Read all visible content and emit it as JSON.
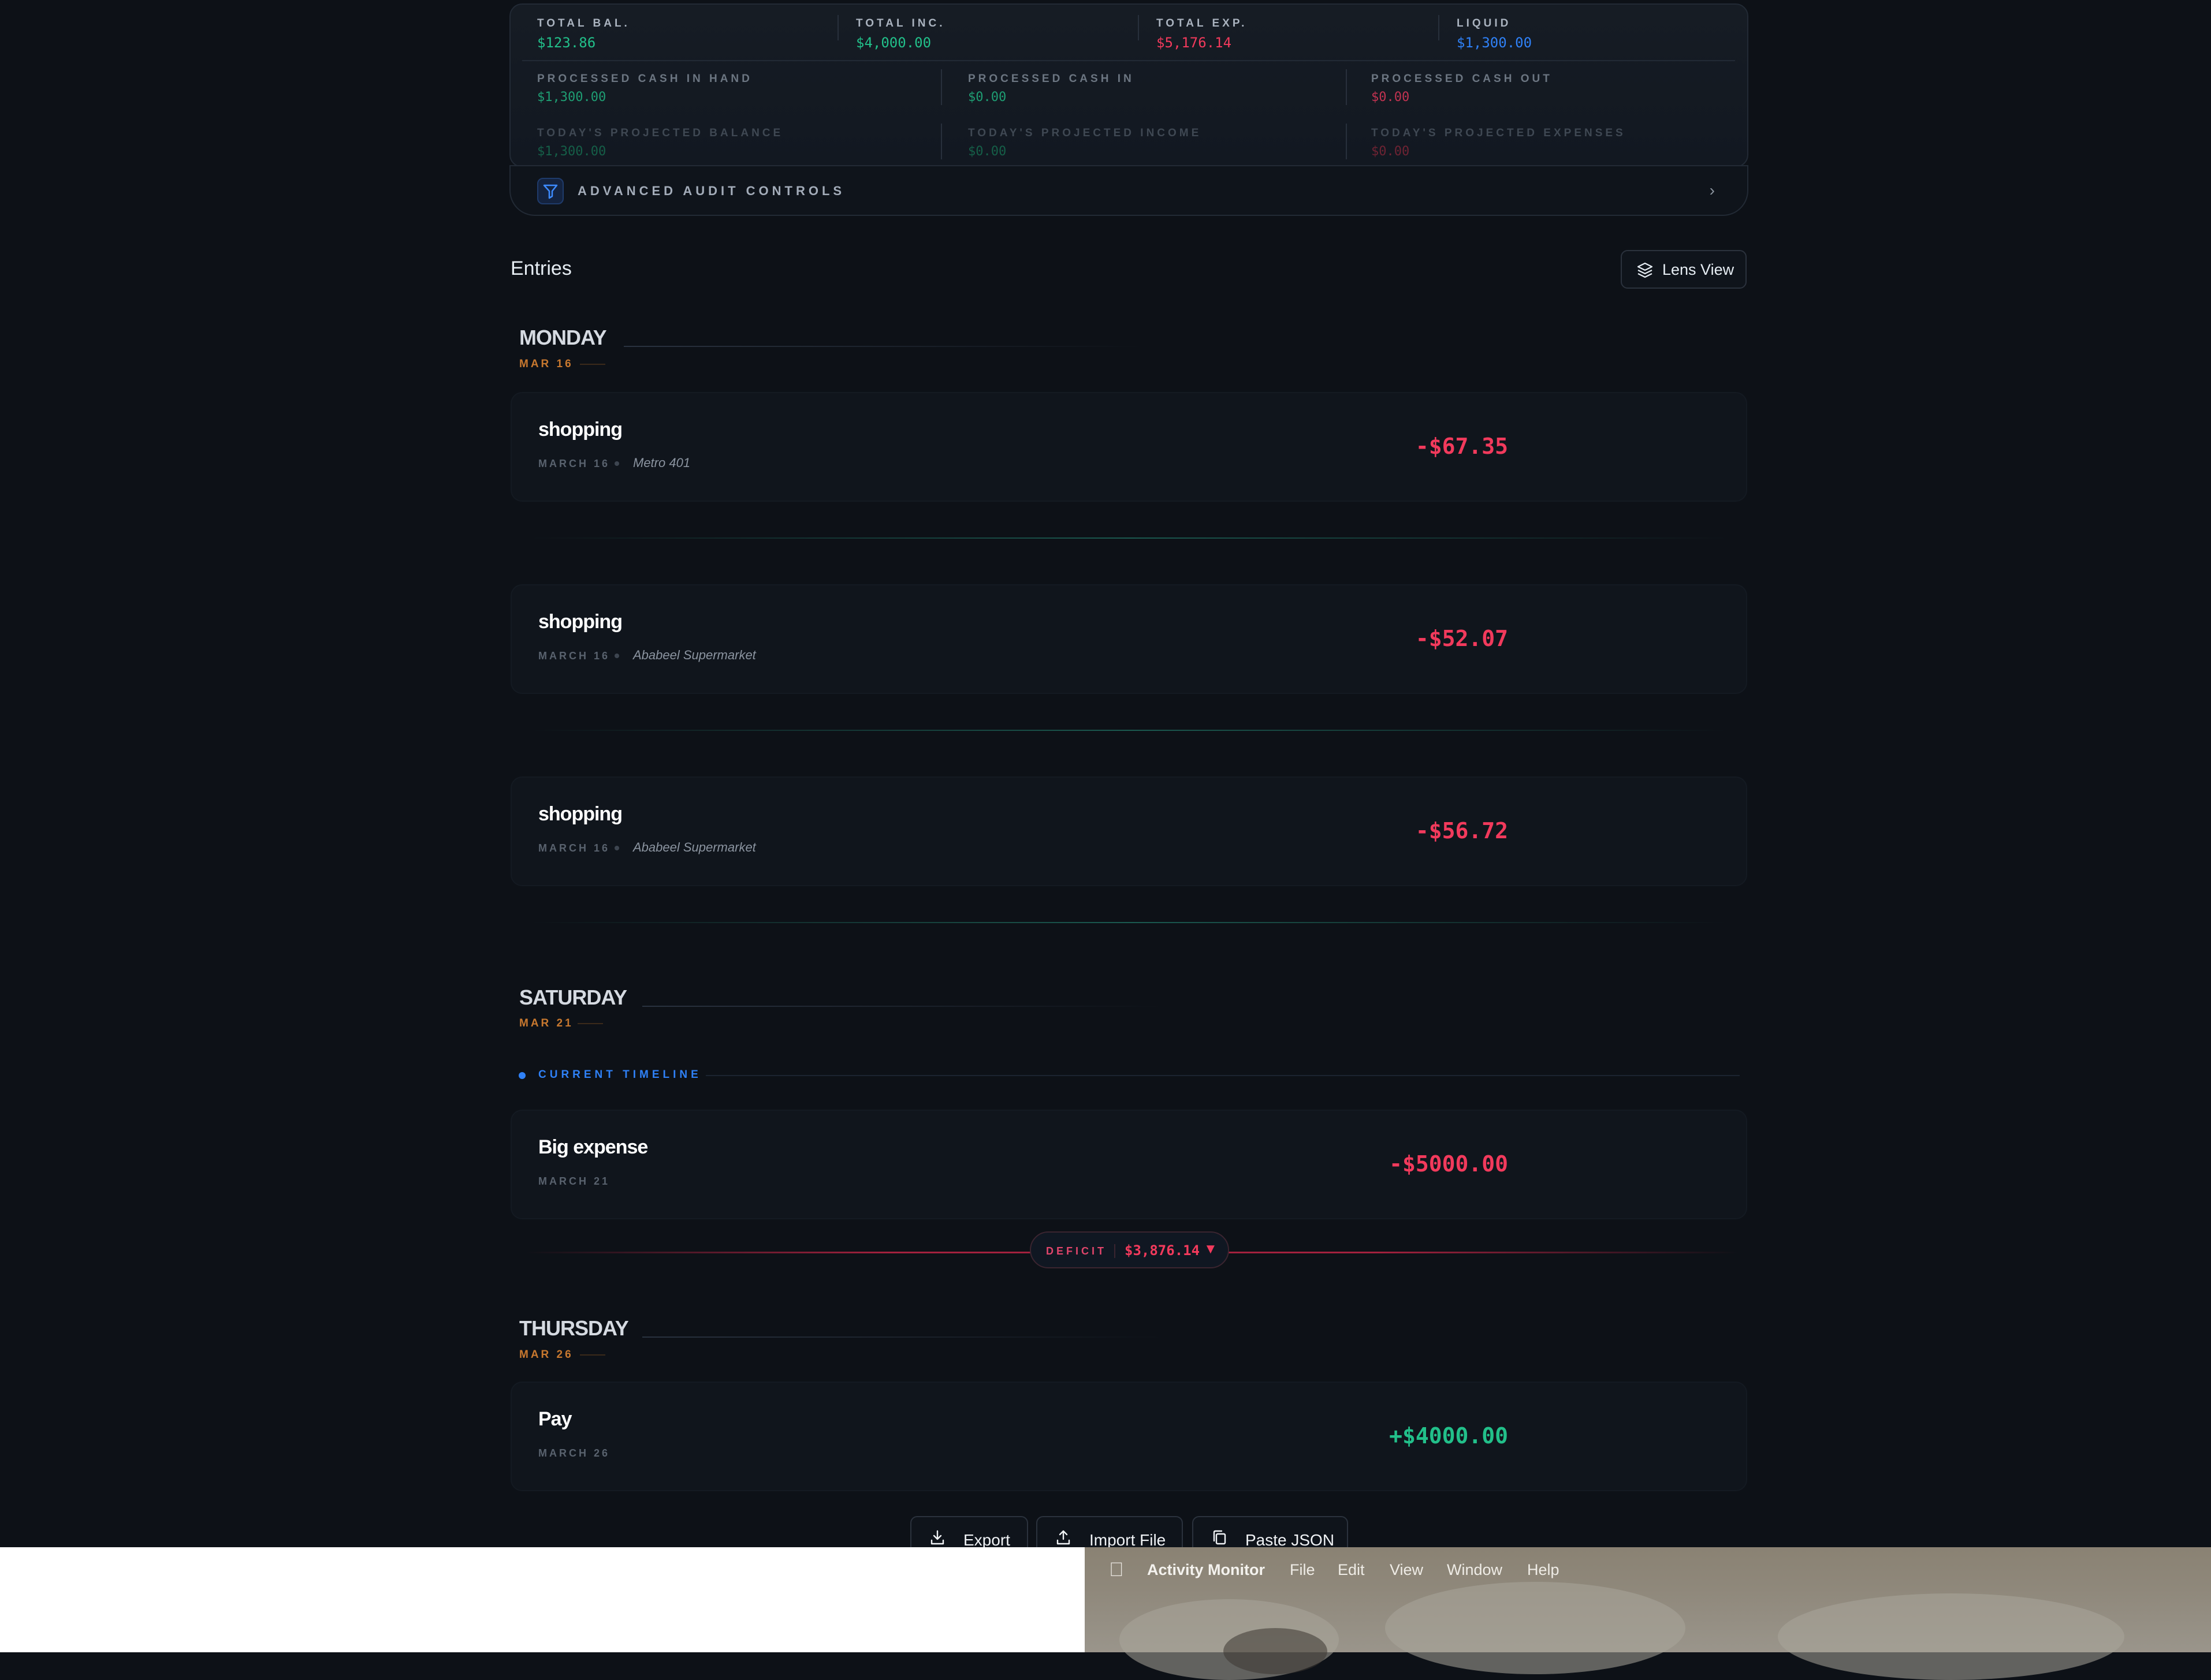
{
  "summary": {
    "row1": [
      {
        "label": "TOTAL BAL.",
        "value": "$123.86",
        "color": "#22c08a"
      },
      {
        "label": "TOTAL INC.",
        "value": "$4,000.00",
        "color": "#22c08a"
      },
      {
        "label": "TOTAL EXP.",
        "value": "$5,176.14",
        "color": "#f23a5c"
      },
      {
        "label": "LIQUID",
        "value": "$1,300.00",
        "color": "#2f81f7"
      }
    ],
    "row2": [
      {
        "label": "PROCESSED CASH IN HAND",
        "value": "$1,300.00"
      },
      {
        "label": "PROCESSED CASH IN",
        "value": "$0.00"
      },
      {
        "label": "PROCESSED CASH OUT",
        "value": "$0.00"
      }
    ],
    "row3": [
      {
        "label": "TODAY'S PROJECTED BALANCE",
        "value": "$1,300.00"
      },
      {
        "label": "TODAY'S PROJECTED INCOME",
        "value": "$0.00"
      },
      {
        "label": "TODAY'S PROJECTED EXPENSES",
        "value": "$0.00"
      }
    ]
  },
  "audit": {
    "label": "ADVANCED AUDIT CONTROLS"
  },
  "entries_title": "Entries",
  "lens_view": "Lens View",
  "days": [
    {
      "day": "MONDAY",
      "date": "MAR 16"
    },
    {
      "day": "SATURDAY",
      "date": "MAR 21"
    },
    {
      "day": "THURSDAY",
      "date": "MAR 26"
    }
  ],
  "entries": [
    {
      "name": "shopping",
      "date": "MARCH 16",
      "place": "Metro 401",
      "amount": "-$67.35"
    },
    {
      "name": "shopping",
      "date": "MARCH 16",
      "place": "Ababeel Supermarket",
      "amount": "-$52.07"
    },
    {
      "name": "shopping",
      "date": "MARCH 16",
      "place": "Ababeel Supermarket",
      "amount": "-$56.72"
    },
    {
      "name": "Big expense",
      "date": "MARCH 21",
      "amount": "-$5000.00"
    },
    {
      "name": "Pay",
      "date": "MARCH 26",
      "amount": "+$4000.00"
    }
  ],
  "timeline": {
    "label": "CURRENT TIMELINE"
  },
  "deficit": {
    "label": "DEFICIT",
    "value": "$3,876.14",
    "arrow": "▼"
  },
  "actions": {
    "export": "Export",
    "import": "Import File",
    "paste": "Paste JSON"
  },
  "menubar": {
    "app": "Activity Monitor",
    "items": [
      "File",
      "Edit",
      "View",
      "Window",
      "Help"
    ]
  },
  "colors": {
    "positive": "#22c08a",
    "negative": "#f23a5c",
    "accent": "#2f81f7",
    "date_accent": "#c7782f"
  }
}
